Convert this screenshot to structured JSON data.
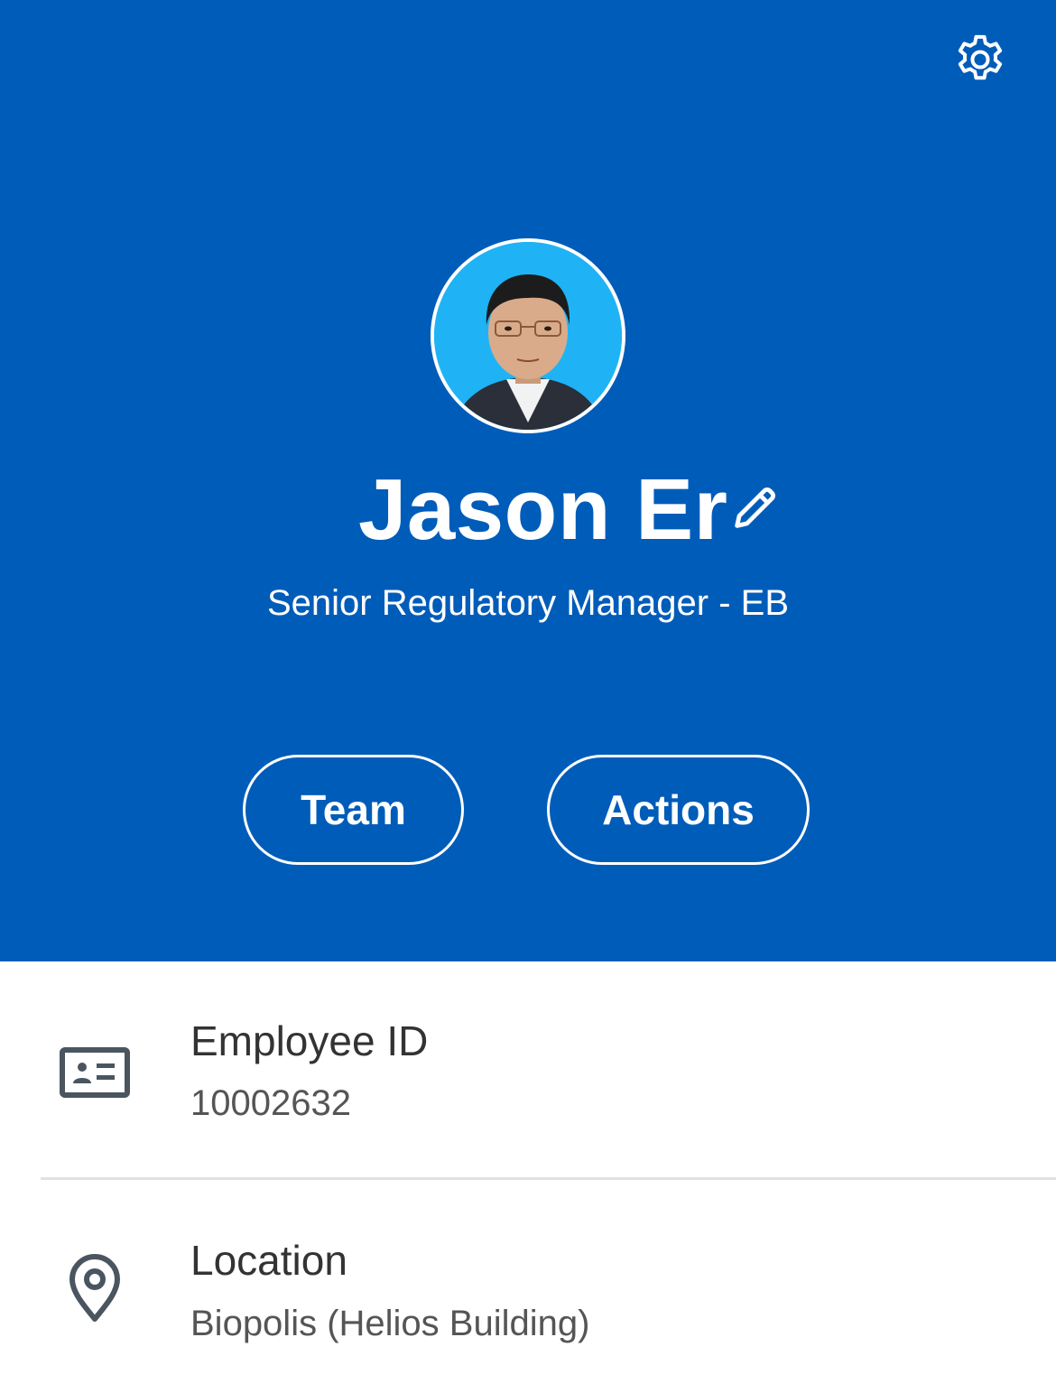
{
  "header": {
    "background_color": "#005cb9",
    "settings_icon": "gear-icon",
    "profile": {
      "name": "Jason Er",
      "edit_icon": "pencil-icon",
      "job_title": "Senior Regulatory Manager - EB"
    },
    "buttons": {
      "team_label": "Team",
      "actions_label": "Actions"
    }
  },
  "details": [
    {
      "icon": "id-card-icon",
      "label": "Employee ID",
      "value": "10002632"
    },
    {
      "icon": "location-pin-icon",
      "label": "Location",
      "value": "Biopolis (Helios Building)"
    }
  ]
}
